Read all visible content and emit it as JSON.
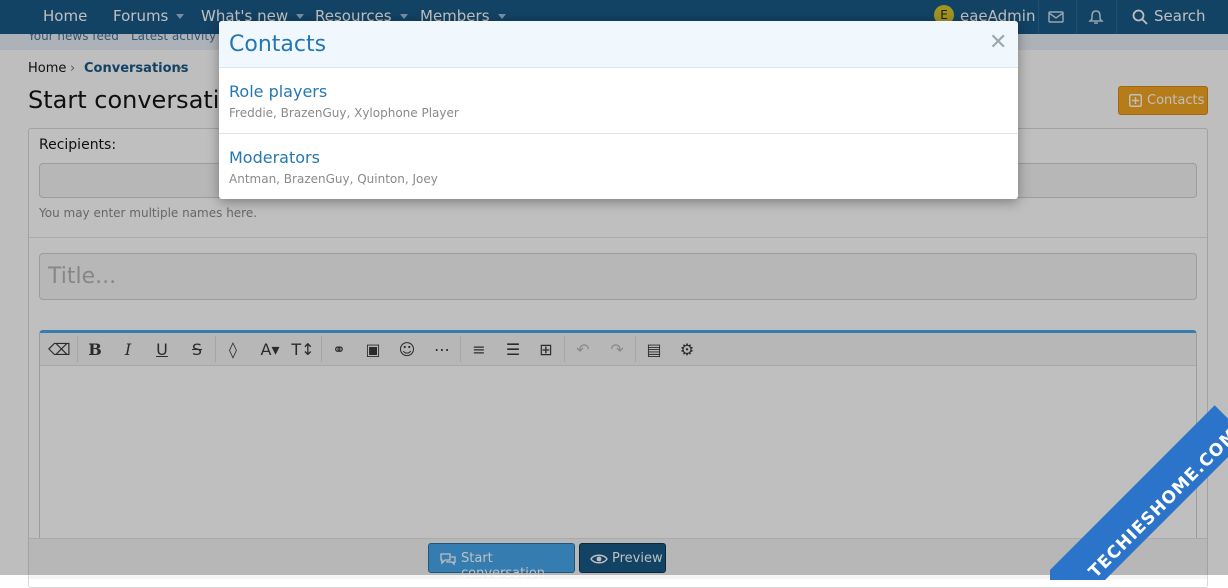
{
  "nav": {
    "items": [
      "Home",
      "Forums",
      "What's new",
      "Resources",
      "Members"
    ],
    "user_initial": "E",
    "username": "eaeAdmin",
    "search_label": "Search"
  },
  "subnav": {
    "items": [
      "Your news feed",
      "Latest activity"
    ]
  },
  "breadcrumb": {
    "home": "Home",
    "current": "Conversations"
  },
  "page": {
    "title": "Start conversation",
    "contacts_button": "Contacts"
  },
  "form": {
    "recipients_label": "Recipients:",
    "recipients_hint": "You may enter multiple names here.",
    "title_placeholder": "Title..."
  },
  "editor": {
    "tools": [
      "eraser-icon",
      "bold-icon",
      "italic-icon",
      "underline-icon",
      "strikethrough-icon",
      "color-icon",
      "font-family-icon",
      "font-size-icon",
      "link-icon",
      "image-icon",
      "smilie-icon",
      "more-icon",
      "align-icon",
      "list-icon",
      "table-icon",
      "undo-icon",
      "redo-icon",
      "draft-icon",
      "settings-icon"
    ]
  },
  "actions": {
    "submit": "Start conversation",
    "preview": "Preview"
  },
  "modal": {
    "title": "Contacts",
    "groups": [
      {
        "name": "Role players",
        "members": "Freddie, BrazenGuy, Xylophone Player"
      },
      {
        "name": "Moderators",
        "members": "Antman, BrazenGuy, Quinton, Joey"
      }
    ]
  },
  "watermark": {
    "text": "TECHIESHOME.COM"
  },
  "colors": {
    "nav": "#185886",
    "accent": "#2577b1",
    "contacts_button": "#f5a623",
    "editor_accent": "#47a7eb"
  }
}
